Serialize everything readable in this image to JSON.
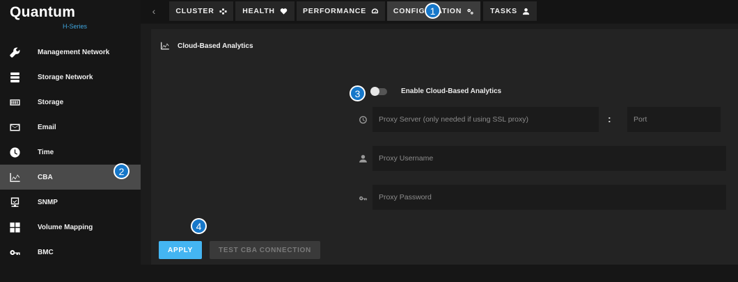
{
  "brand": {
    "name": "Quantum",
    "subtitle": "H-Series"
  },
  "sidebar": {
    "items": [
      {
        "label": "Management Network",
        "icon": "wrench-icon"
      },
      {
        "label": "Storage Network",
        "icon": "server-icon"
      },
      {
        "label": "Storage",
        "icon": "storage-icon"
      },
      {
        "label": "Email",
        "icon": "envelope-icon"
      },
      {
        "label": "Time",
        "icon": "clock-icon"
      },
      {
        "label": "CBA",
        "icon": "chart-icon",
        "active": true
      },
      {
        "label": "SNMP",
        "icon": "monitor-icon"
      },
      {
        "label": "Volume Mapping",
        "icon": "grid-icon"
      },
      {
        "label": "BMC",
        "icon": "key-icon"
      }
    ]
  },
  "tabs": [
    {
      "label": "CLUSTER",
      "icon": "cluster-icon"
    },
    {
      "label": "HEALTH",
      "icon": "heart-icon"
    },
    {
      "label": "PERFORMANCE",
      "icon": "gauge-icon"
    },
    {
      "label": "CONFIGURATION",
      "icon": "gears-icon",
      "active": true
    },
    {
      "label": "TASKS",
      "icon": "user-icon"
    }
  ],
  "panel": {
    "title": "Cloud-Based Analytics",
    "toggle_label": "Enable Cloud-Based Analytics",
    "toggle_on": false,
    "proxy_server_placeholder": "Proxy Server (only needed if using SSL proxy)",
    "port_placeholder": "Port",
    "username_placeholder": "Proxy Username",
    "password_placeholder": "Proxy Password",
    "apply_label": "APPLY",
    "test_label": "TEST CBA CONNECTION"
  },
  "callouts": [
    "1",
    "2",
    "3",
    "4"
  ],
  "colors": {
    "accent": "#44b5f2",
    "callout": "#1677c9",
    "brand_sub": "#3fa7e0"
  }
}
